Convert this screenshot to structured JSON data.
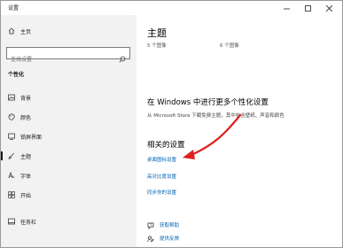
{
  "window": {
    "title": "设置"
  },
  "sidebar": {
    "home_label": "主页",
    "search": {
      "placeholder": "查找设置"
    },
    "section_label": "个性化",
    "items": [
      {
        "label": "背景",
        "icon": "image-icon"
      },
      {
        "label": "颜色",
        "icon": "palette-icon"
      },
      {
        "label": "锁屏界面",
        "icon": "lock-screen-icon"
      },
      {
        "label": "主题",
        "icon": "theme-brush-icon",
        "active": true
      },
      {
        "label": "字体",
        "icon": "font-icon"
      },
      {
        "label": "开始",
        "icon": "start-icon"
      },
      {
        "label": "任务栏",
        "icon": "taskbar-icon"
      }
    ]
  },
  "main": {
    "title": "主题",
    "themes": [
      {
        "label": "5 个图像"
      },
      {
        "label": "6 个图像"
      }
    ],
    "store_heading": "在 Windows 中进行更多个性化设置",
    "store_text": "从 Microsoft Store 下载免费主题，其中包含壁纸、声音和颜色",
    "related_heading": "相关的设置",
    "related_links": [
      {
        "label": "桌面图标设置"
      },
      {
        "label": "高对比度设置"
      },
      {
        "label": "同步你的设置"
      }
    ],
    "help_links": [
      {
        "label": "获取帮助",
        "icon": "help-icon"
      },
      {
        "label": "提供反馈",
        "icon": "feedback-icon"
      }
    ]
  },
  "colors": {
    "accent": "#0063b1",
    "arrow": "#e0201c",
    "sidebar_bg": "#f2f2f2"
  }
}
